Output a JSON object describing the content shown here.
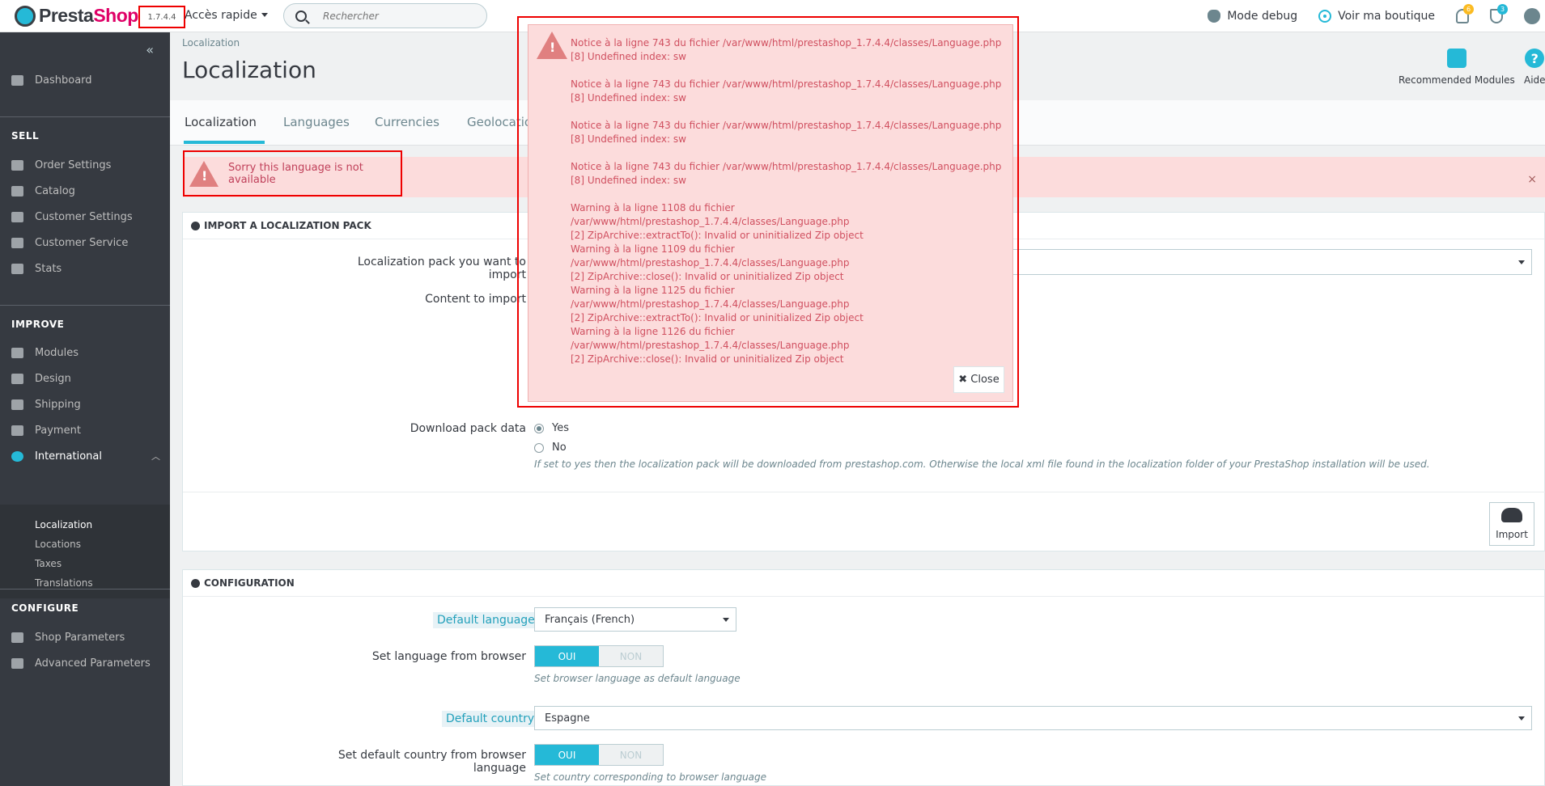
{
  "header": {
    "logo_text_1": "Presta",
    "logo_text_2": "Shop",
    "version": "1.7.4.4",
    "quick_access": "Accès rapide",
    "search_placeholder": "Rechercher",
    "debug_mode": "Mode debug",
    "view_shop": "Voir ma boutique",
    "notifications_count": "6",
    "trophy_count": "3"
  },
  "sidebar": {
    "collapse": "«",
    "dashboard": "Dashboard",
    "sections": {
      "sell": "SELL",
      "improve": "IMPROVE",
      "configure": "CONFIGURE"
    },
    "sell_items": [
      "Order Settings",
      "Catalog",
      "Customer Settings",
      "Customer Service",
      "Stats"
    ],
    "improve_items": [
      "Modules",
      "Design",
      "Shipping",
      "Payment",
      "International"
    ],
    "international_sub": [
      "Localization",
      "Locations",
      "Taxes",
      "Translations"
    ],
    "configure_items": [
      "Shop Parameters",
      "Advanced Parameters"
    ]
  },
  "page": {
    "breadcrumb": "Localization",
    "title": "Localization",
    "recommended_modules": "Recommended Modules",
    "help": "Aide",
    "tabs": [
      "Localization",
      "Languages",
      "Currencies",
      "Geolocation"
    ],
    "alert_text": "Sorry this language is not available",
    "alert_close": "×"
  },
  "import_panel": {
    "heading": "IMPORT A LOCALIZATION PACK",
    "pack_label": "Localization pack you want to import",
    "content_label": "Content to import",
    "download_label": "Download pack data",
    "yes": "Yes",
    "no": "No",
    "download_help": "If set to yes then the localization pack will be downloaded from prestashop.com. Otherwise the local xml file found in the localization folder of your PrestaShop installation will be used.",
    "import_button": "Import"
  },
  "config_panel": {
    "heading": "CONFIGURATION",
    "default_language_label": "Default language",
    "default_language_value": "Français (French)",
    "browser_lang_label": "Set language from browser",
    "browser_lang_help": "Set browser language as default language",
    "default_country_label": "Default country",
    "default_country_value": "Espagne",
    "browser_country_label": "Set default country from browser language",
    "browser_country_help": "Set country corresponding to browser language",
    "toggle_on": "OUI",
    "toggle_off": "NON"
  },
  "modal": {
    "messages": [
      {
        "line1": "Notice à la ligne 743 du fichier /var/www/html/prestashop_1.7.4.4/classes/Language.php",
        "line2": "[8] Undefined index: sw"
      },
      {
        "line1": "Notice à la ligne 743 du fichier /var/www/html/prestashop_1.7.4.4/classes/Language.php",
        "line2": "[8] Undefined index: sw"
      },
      {
        "line1": "Notice à la ligne 743 du fichier /var/www/html/prestashop_1.7.4.4/classes/Language.php",
        "line2": "[8] Undefined index: sw"
      },
      {
        "line1": "Notice à la ligne 743 du fichier /var/www/html/prestashop_1.7.4.4/classes/Language.php",
        "line2": "[8] Undefined index: sw"
      },
      {
        "line1": "Warning à la ligne 1108 du fichier /var/www/html/prestashop_1.7.4.4/classes/Language.php",
        "line2": "[2] ZipArchive::extractTo(): Invalid or uninitialized Zip object"
      },
      {
        "line1": "Warning à la ligne 1109 du fichier /var/www/html/prestashop_1.7.4.4/classes/Language.php",
        "line2": "[2] ZipArchive::close(): Invalid or uninitialized Zip object"
      },
      {
        "line1": "Warning à la ligne 1125 du fichier /var/www/html/prestashop_1.7.4.4/classes/Language.php",
        "line2": "[2] ZipArchive::extractTo(): Invalid or uninitialized Zip object"
      },
      {
        "line1": "Warning à la ligne 1126 du fichier /var/www/html/prestashop_1.7.4.4/classes/Language.php",
        "line2": "[2] ZipArchive::close(): Invalid or uninitialized Zip object"
      }
    ],
    "close_label": "✖ Close"
  }
}
